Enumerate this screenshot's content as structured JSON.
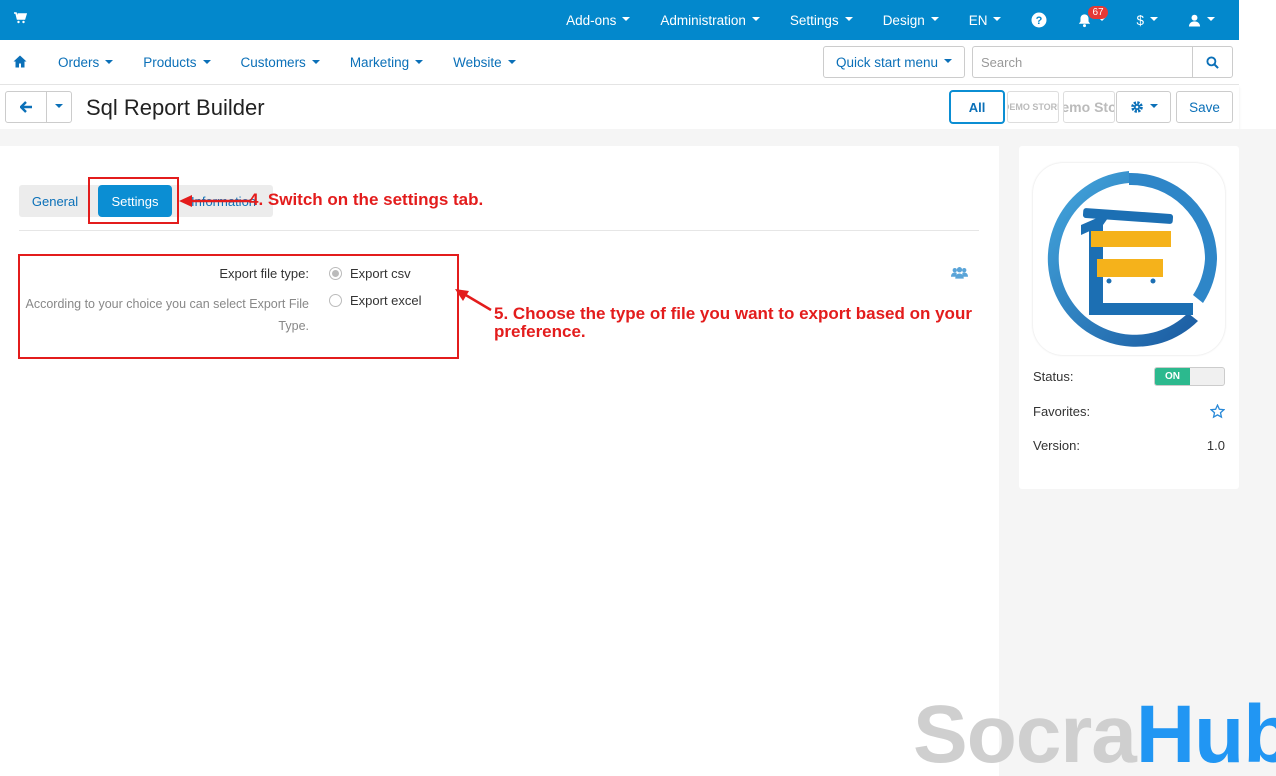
{
  "topbar": {
    "items": [
      {
        "label": "Add-ons"
      },
      {
        "label": "Administration"
      },
      {
        "label": "Settings"
      },
      {
        "label": "Design"
      },
      {
        "label": "EN"
      }
    ],
    "notifications_count": "67",
    "currency": "$",
    "color": "#0388cc"
  },
  "navbar": {
    "items": [
      {
        "label": "Orders"
      },
      {
        "label": "Products"
      },
      {
        "label": "Customers"
      },
      {
        "label": "Marketing"
      },
      {
        "label": "Website"
      }
    ],
    "quick_start": "Quick start menu",
    "search_placeholder": "Search"
  },
  "titlebar": {
    "title": "Sql Report Builder",
    "all_label": "All",
    "store1_label": "DEMO STORE",
    "store2_label": "emo Sto",
    "save_label": "Save"
  },
  "tabs": {
    "general": "General",
    "settings": "Settings",
    "information": "Information"
  },
  "settings": {
    "field_label": "Export file type:",
    "field_help": "According to your choice you can select Export File Type.",
    "options": [
      {
        "label": "Export csv",
        "checked": true
      },
      {
        "label": "Export excel",
        "checked": false
      }
    ]
  },
  "annotations": {
    "step4": "4. Switch on the settings tab.",
    "step5": "5. Choose the type of file you want to export based on your preference."
  },
  "sidebar": {
    "status_label": "Status:",
    "status_value": "ON",
    "favorites_label": "Favorites:",
    "version_label": "Version:",
    "version_value": "1.0"
  },
  "watermark": {
    "part1": "Socra",
    "part2": "Hub"
  }
}
